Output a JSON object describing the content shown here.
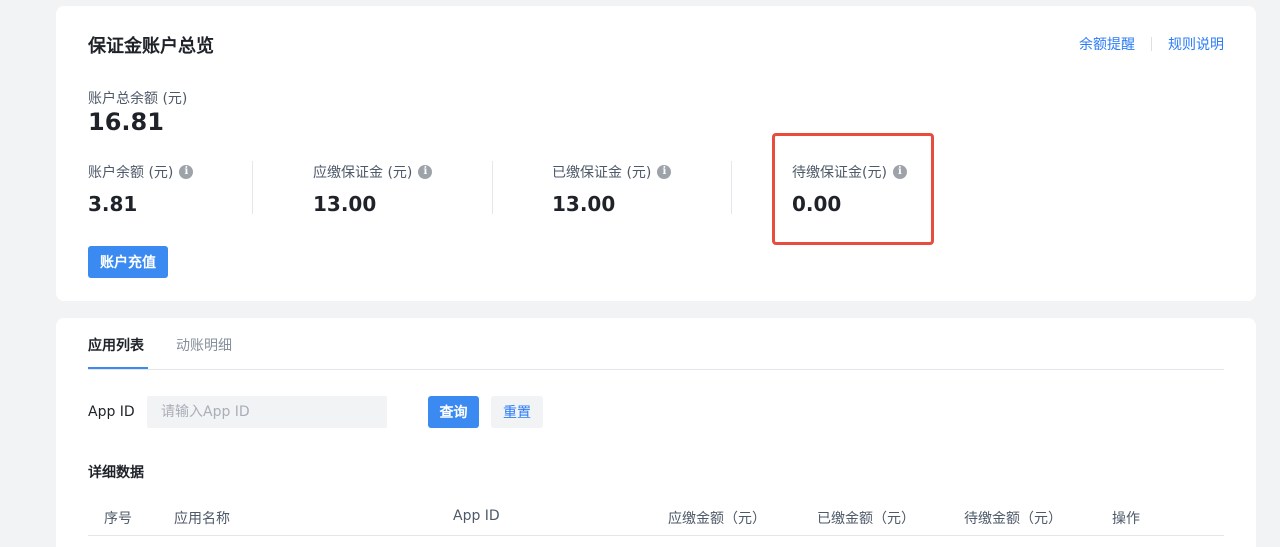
{
  "overview": {
    "title": "保证金账户总览",
    "links": [
      "余额提醒",
      "规则说明"
    ],
    "total_label": "账户总余额 (元)",
    "total_value": "16.81",
    "stats": [
      {
        "label": "账户余额 (元)",
        "value": "3.81"
      },
      {
        "label": "应缴保证金 (元)",
        "value": "13.00"
      },
      {
        "label": "已缴保证金 (元)",
        "value": "13.00"
      },
      {
        "label": "待缴保证金(元)",
        "value": "0.00"
      }
    ],
    "info_glyph": "i",
    "recharge_button": "账户充值"
  },
  "list": {
    "tabs": [
      "应用列表",
      "动账明细"
    ],
    "active_tab": 0,
    "filter": {
      "label": "App ID",
      "placeholder": "请输入App ID",
      "value": "",
      "query_button": "查询",
      "reset_button": "重置"
    },
    "section_title": "详细数据",
    "columns": [
      "序号",
      "应用名称",
      "App ID",
      "应缴金额（元）",
      "已缴金额（元）",
      "待缴金额（元）",
      "操作"
    ]
  },
  "colors": {
    "accent": "#3b8af2",
    "link": "#2b7cf6",
    "highlight": "#e74c3c"
  }
}
